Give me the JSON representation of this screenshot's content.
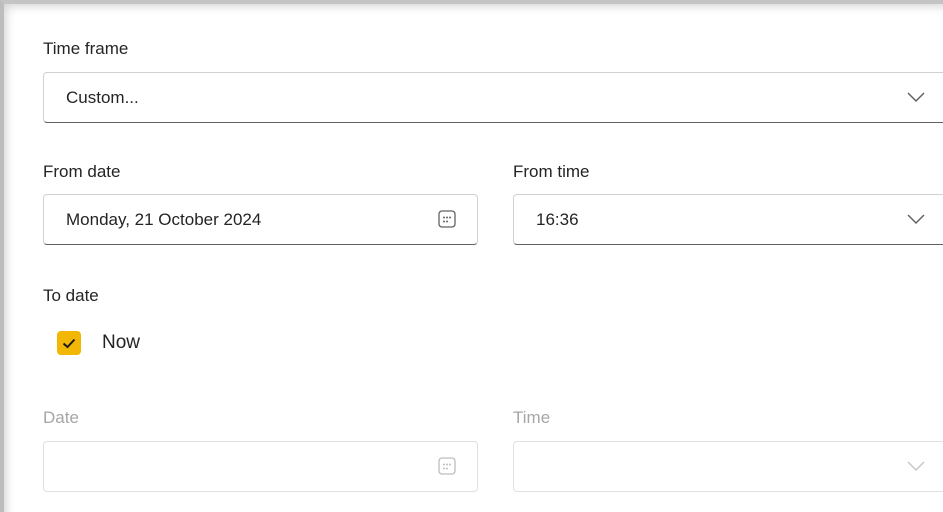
{
  "time_frame": {
    "label": "Time frame",
    "value": "Custom..."
  },
  "from": {
    "date_label": "From date",
    "date_value": "Monday, 21 October 2024",
    "time_label": "From time",
    "time_value": "16:36"
  },
  "to": {
    "label": "To date",
    "now_label": "Now",
    "now_checked": true,
    "date_label": "Date",
    "date_value": "",
    "time_label": "Time",
    "time_value": ""
  },
  "colors": {
    "checkbox_accent": "#f2b705",
    "text": "#242424",
    "disabled_text": "#a6a6a6"
  },
  "icons": {
    "dropdown": "chevron-down-icon",
    "date_picker": "calendar-icon",
    "check": "checkmark-icon"
  }
}
